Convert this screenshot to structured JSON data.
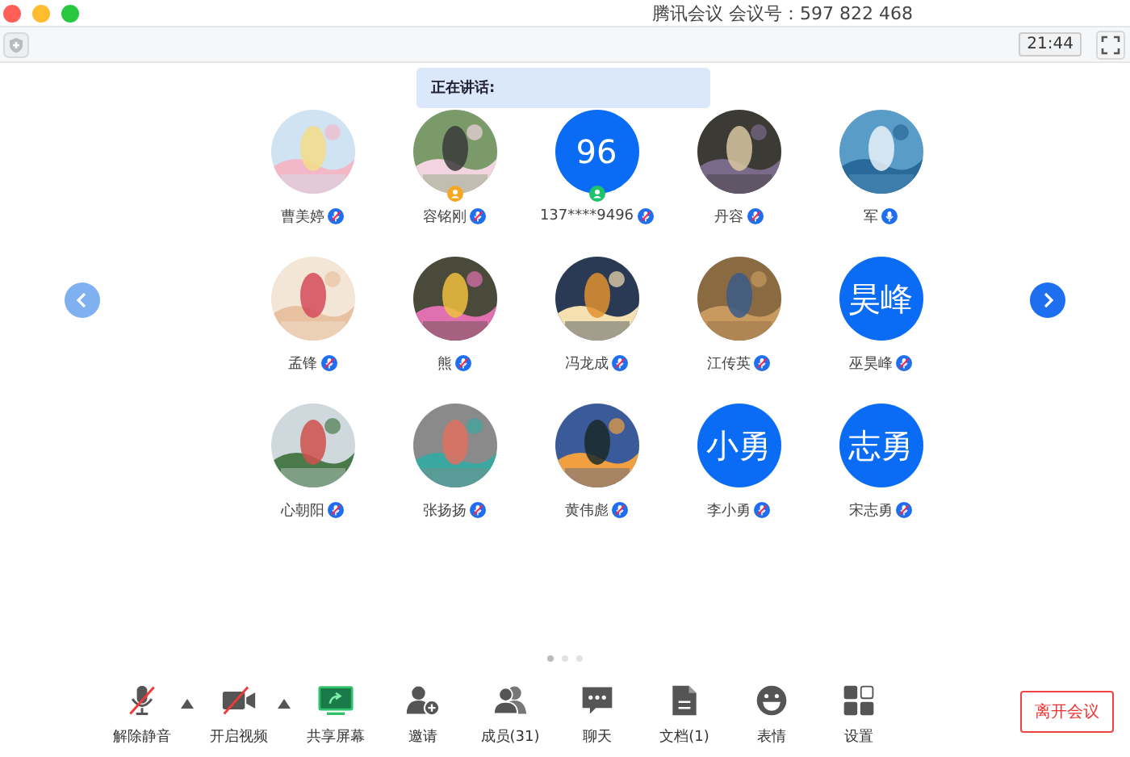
{
  "window": {
    "title": "腾讯会议 会议号：597 822 468"
  },
  "top_bar": {
    "time": "21:44"
  },
  "speaking": {
    "label": "正在讲话:"
  },
  "participants": [
    {
      "name": "曹美婷",
      "muted": true
    },
    {
      "name": "容铭刚",
      "muted": true,
      "badge": {
        "color": "#f5a623"
      }
    },
    {
      "name": "137****9496",
      "avatar": {
        "kind": "text",
        "text": "96"
      },
      "muted": true,
      "badge": {
        "color": "#1fc26b"
      }
    },
    {
      "name": "丹容",
      "muted": true
    },
    {
      "name": "军",
      "muted": false
    },
    {
      "name": "孟锋",
      "muted": true
    },
    {
      "name": "熊",
      "muted": true
    },
    {
      "name": "冯龙成",
      "muted": true
    },
    {
      "name": "江传英",
      "muted": true
    },
    {
      "name": "巫昊峰",
      "avatar": {
        "kind": "text",
        "text": "昊峰"
      },
      "muted": true
    },
    {
      "name": "心朝阳",
      "muted": true
    },
    {
      "name": "张扬扬",
      "muted": true
    },
    {
      "name": "黄伟彪",
      "muted": true
    },
    {
      "name": "李小勇",
      "avatar": {
        "kind": "text",
        "text": "小勇"
      },
      "muted": true
    },
    {
      "name": "宋志勇",
      "avatar": {
        "kind": "text",
        "text": "志勇"
      },
      "muted": true
    }
  ],
  "pages": [
    {
      "selected": true
    },
    {
      "selected": false
    },
    {
      "selected": false
    }
  ],
  "toolbar": [
    {
      "kind": "mic",
      "label": "解除静音",
      "off": true,
      "has_menu": true
    },
    {
      "kind": "video",
      "label": "开启视频",
      "off": true,
      "has_menu": true
    },
    {
      "kind": "share",
      "label": "共享屏幕"
    },
    {
      "kind": "invite",
      "label": "邀请"
    },
    {
      "kind": "members",
      "label": "成员(31)"
    },
    {
      "kind": "chat",
      "label": "聊天"
    },
    {
      "kind": "doc",
      "label": "文档(1)"
    },
    {
      "kind": "emoji",
      "label": "表情"
    },
    {
      "kind": "settings",
      "label": "设置"
    }
  ],
  "leave_button": {
    "label": "离开会议"
  }
}
